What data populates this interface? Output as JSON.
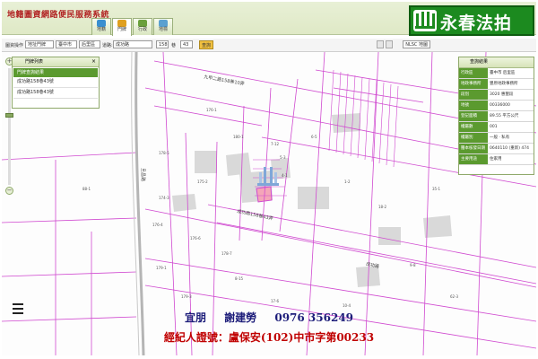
{
  "header": {
    "app_title": "地籍圖資網路便民服務系統",
    "tabs": [
      {
        "label": "地籍",
        "color": "#3a8fd0"
      },
      {
        "label": "門牌",
        "color": "#e0a020"
      },
      {
        "label": "行政",
        "color": "#6aa03c"
      },
      {
        "label": "地標",
        "color": "#5aa0d0"
      }
    ],
    "active_tab": "門牌"
  },
  "brand": {
    "name": "永春法拍",
    "logo_text": "永春"
  },
  "toolbar": {
    "search_label": "圖資操作",
    "mode_select": "地址門牌",
    "city_select": "臺中市",
    "district_select": "后里區",
    "road_label": "道路:",
    "road_value": "成功路",
    "number_value": "158",
    "unit_label": "巷",
    "number2_value": "43",
    "go_label": "查詢",
    "basemap_select": "NLSC 地圖"
  },
  "left_panel": {
    "title": "門牌列表",
    "subtitle": "門牌查詢結果",
    "items": [
      "成功路158巷43號",
      "成功路158巷43號"
    ]
  },
  "right_panel": {
    "title": "查詢結果",
    "rows": [
      {
        "key": "行政區",
        "value": "臺中市 后里區"
      },
      {
        "key": "地政事務所",
        "value": "豐原地政事務所"
      },
      {
        "key": "段別",
        "value": "3020 惠豐段"
      },
      {
        "key": "地號",
        "value": "00336000"
      },
      {
        "key": "登記面積",
        "value": "89.55 平方公尺"
      },
      {
        "key": "權屬數",
        "value": "001"
      },
      {
        "key": "權屬別",
        "value": "一般 · 私有"
      },
      {
        "key": "謄本核發日期",
        "value": "0640110 (重新) 474"
      },
      {
        "key": "主要用途",
        "value": "住家用"
      }
    ]
  },
  "map": {
    "road_labels": [
      "九甲二路158巷10弄",
      "成功路158巷43弄",
      "成功路",
      "旦昌路"
    ],
    "parcel_numbers": [
      "176-1",
      "178-5",
      "176-4",
      "180-1",
      "175-2",
      "179-1",
      "179-3",
      "178-7",
      "176-6",
      "174-3",
      "7-12",
      "6-5",
      "5-3",
      "4-1",
      "1-2",
      "8-15",
      "17-6",
      "18-2",
      "35-1",
      "9-8",
      "10-4",
      "62-3",
      "88-1"
    ]
  },
  "overlay": {
    "agent_name": "宜朋",
    "agent_person": "謝建勞",
    "agent_phone": "0976 356249",
    "license_text": "經紀人證號：盧保安(102)中市字第00233"
  },
  "colors": {
    "parcel_line": "#d04ad0",
    "building_fill": "#d9d9d9",
    "brand_green": "#1c8a1f",
    "panel_green": "#5b9a2f",
    "selected_parcel": "#f4a6b8"
  }
}
